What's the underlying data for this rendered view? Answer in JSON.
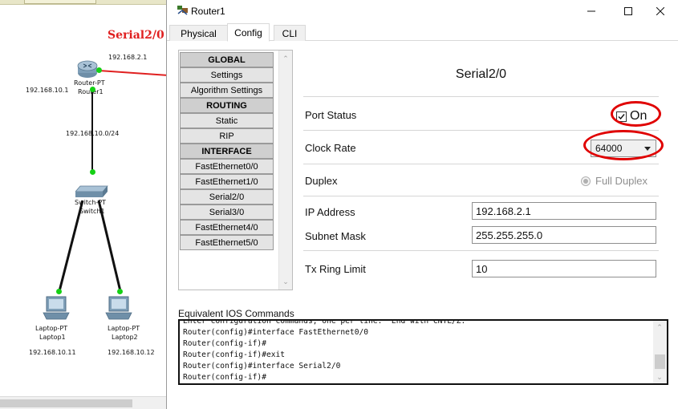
{
  "window": {
    "title": "Router1",
    "controls": {
      "minimize": "minimize",
      "maximize": "maximize",
      "close": "close"
    }
  },
  "tabs": [
    {
      "label": "Physical",
      "active": false
    },
    {
      "label": "Config",
      "active": true
    },
    {
      "label": "CLI",
      "active": false
    }
  ],
  "nav": {
    "items": [
      {
        "label": "GLOBAL",
        "header": true
      },
      {
        "label": "Settings",
        "header": false
      },
      {
        "label": "Algorithm Settings",
        "header": false
      },
      {
        "label": "ROUTING",
        "header": true
      },
      {
        "label": "Static",
        "header": false
      },
      {
        "label": "RIP",
        "header": false
      },
      {
        "label": "INTERFACE",
        "header": true
      },
      {
        "label": "FastEthernet0/0",
        "header": false
      },
      {
        "label": "FastEthernet1/0",
        "header": false
      },
      {
        "label": "Serial2/0",
        "header": false
      },
      {
        "label": "Serial3/0",
        "header": false
      },
      {
        "label": "FastEthernet4/0",
        "header": false
      },
      {
        "label": "FastEthernet5/0",
        "header": false
      }
    ]
  },
  "panel": {
    "title": "Serial2/0",
    "port_status": {
      "label": "Port Status",
      "checked": true,
      "value": "On"
    },
    "clock_rate": {
      "label": "Clock Rate",
      "selected": "64000"
    },
    "duplex": {
      "label": "Duplex",
      "option": "Full Duplex",
      "enabled": false
    },
    "ip_address": {
      "label": "IP Address",
      "value": "192.168.2.1"
    },
    "subnet_mask": {
      "label": "Subnet Mask",
      "value": "255.255.255.0"
    },
    "tx_ring_limit": {
      "label": "Tx Ring Limit",
      "value": "10"
    }
  },
  "ios": {
    "label": "Equivalent IOS Commands",
    "lines": [
      "Enter configuration commands, one per line.  End with CNTL/Z.",
      "Router(config)#interface FastEthernet0/0",
      "Router(config-if)#",
      "Router(config-if)#exit",
      "Router(config)#interface Serial2/0",
      "Router(config-if)#"
    ]
  },
  "topology": {
    "serial_label": "Serial2/0",
    "router_serial_ip": "192.168.2.1",
    "router_fa_ip": "192.168.10.1",
    "router_name": "Router-PT",
    "router_hostname": "Router1",
    "network_label": "192.168.10.0/24",
    "switch_name": "Switch-PT",
    "switch_hostname": "Switch1",
    "laptops": [
      {
        "model": "Laptop-PT",
        "name": "Laptop1",
        "ip": "192.168.10.11"
      },
      {
        "model": "Laptop-PT",
        "name": "Laptop2",
        "ip": "192.168.10.12"
      }
    ]
  },
  "colors": {
    "annotation_red": "#e00000",
    "link_green": "#15d015",
    "serial_link_red": "#e02020"
  }
}
